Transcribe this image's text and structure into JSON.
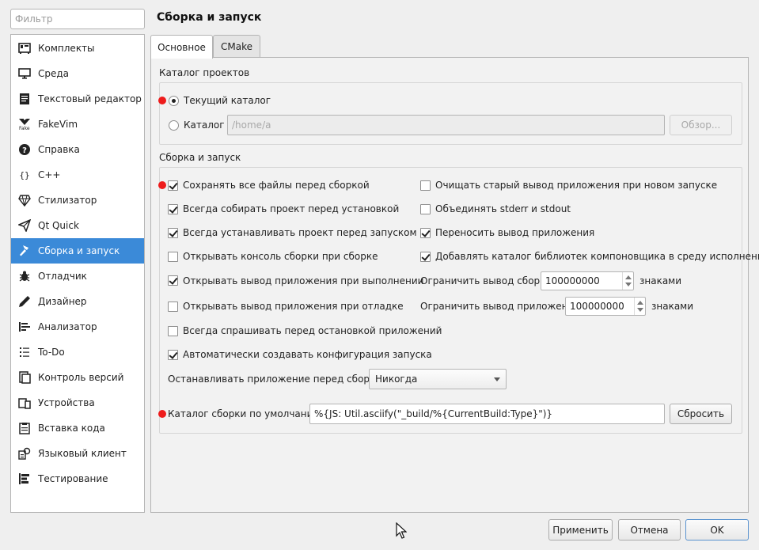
{
  "filter": {
    "placeholder": "Фильтр"
  },
  "sidebar": {
    "items": [
      {
        "label": "Комплекты",
        "icon": "kits-icon"
      },
      {
        "label": "Среда",
        "icon": "monitor-icon"
      },
      {
        "label": "Текстовый редактор",
        "icon": "text-editor-icon"
      },
      {
        "label": "FakeVim",
        "icon": "fakevim-icon"
      },
      {
        "label": "Справка",
        "icon": "help-icon"
      },
      {
        "label": "C++",
        "icon": "braces-icon"
      },
      {
        "label": "Стилизатор",
        "icon": "diamond-icon"
      },
      {
        "label": "Qt Quick",
        "icon": "paper-plane-icon"
      },
      {
        "label": "Сборка и запуск",
        "icon": "hammer-icon",
        "selected": true
      },
      {
        "label": "Отладчик",
        "icon": "bug-icon"
      },
      {
        "label": "Дизайнер",
        "icon": "pen-icon"
      },
      {
        "label": "Анализатор",
        "icon": "analyzer-icon"
      },
      {
        "label": "To-Do",
        "icon": "todo-list-icon"
      },
      {
        "label": "Контроль версий",
        "icon": "version-control-icon"
      },
      {
        "label": "Устройства",
        "icon": "devices-icon"
      },
      {
        "label": "Вставка кода",
        "icon": "code-paste-icon"
      },
      {
        "label": "Языковый клиент",
        "icon": "language-client-icon"
      },
      {
        "label": "Тестирование",
        "icon": "testing-icon"
      }
    ]
  },
  "page": {
    "title": "Сборка и запуск"
  },
  "tabs": [
    {
      "label": "Основное",
      "active": true
    },
    {
      "label": "CMake",
      "active": false
    }
  ],
  "projects_dir": {
    "title": "Каталог проектов",
    "current_label": "Текущий каталог",
    "dir_label": "Каталог",
    "path_value": "/home/a",
    "browse_label": "Обзор..."
  },
  "build_run": {
    "title": "Сборка и запуск",
    "left_options": [
      {
        "label": "Сохранять все файлы перед сборкой",
        "checked": true
      },
      {
        "label": "Всегда собирать проект перед установкой",
        "checked": true
      },
      {
        "label": "Всегда устанавливать проект перед запуском",
        "checked": true
      },
      {
        "label": "Открывать консоль сборки при сборке",
        "checked": false
      },
      {
        "label": "Открывать вывод приложения при выполнении",
        "checked": true
      },
      {
        "label": "Открывать вывод приложения при отладке",
        "checked": false
      },
      {
        "label": "Всегда спрашивать перед остановкой приложений",
        "checked": false
      },
      {
        "label": "Автоматически создавать конфигурация запуска",
        "checked": true
      }
    ],
    "right_options": [
      {
        "label": "Очищать старый вывод приложения при новом запуске",
        "checked": false
      },
      {
        "label": "Объединять stderr и stdout",
        "checked": false
      },
      {
        "label": "Переносить вывод приложения",
        "checked": true
      },
      {
        "label": "Добавлять каталог библиотек компоновщика в среду исполнения",
        "checked": true
      }
    ],
    "limit_build_label": "Ограничить вывод сборки",
    "limit_build_value": "100000000",
    "limit_app_label": "Ограничить вывод приложения",
    "limit_app_value": "100000000",
    "chars_label": "знаками",
    "stop_before_build_label": "Останавливать приложение перед сборкой:",
    "stop_before_build_value": "Никогда",
    "default_build_dir_label": "Каталог сборки по умолчанию:",
    "default_build_dir_value": "%{JS: Util.asciify(\"_build/%{CurrentBuild:Type}\")}",
    "reset_label": "Сбросить"
  },
  "footer": {
    "apply_label": "Применить",
    "cancel_label": "Отмена",
    "ok_label": "OK"
  },
  "colors": {
    "selection": "#3b8ad8",
    "marker": "#ee1c1c"
  }
}
